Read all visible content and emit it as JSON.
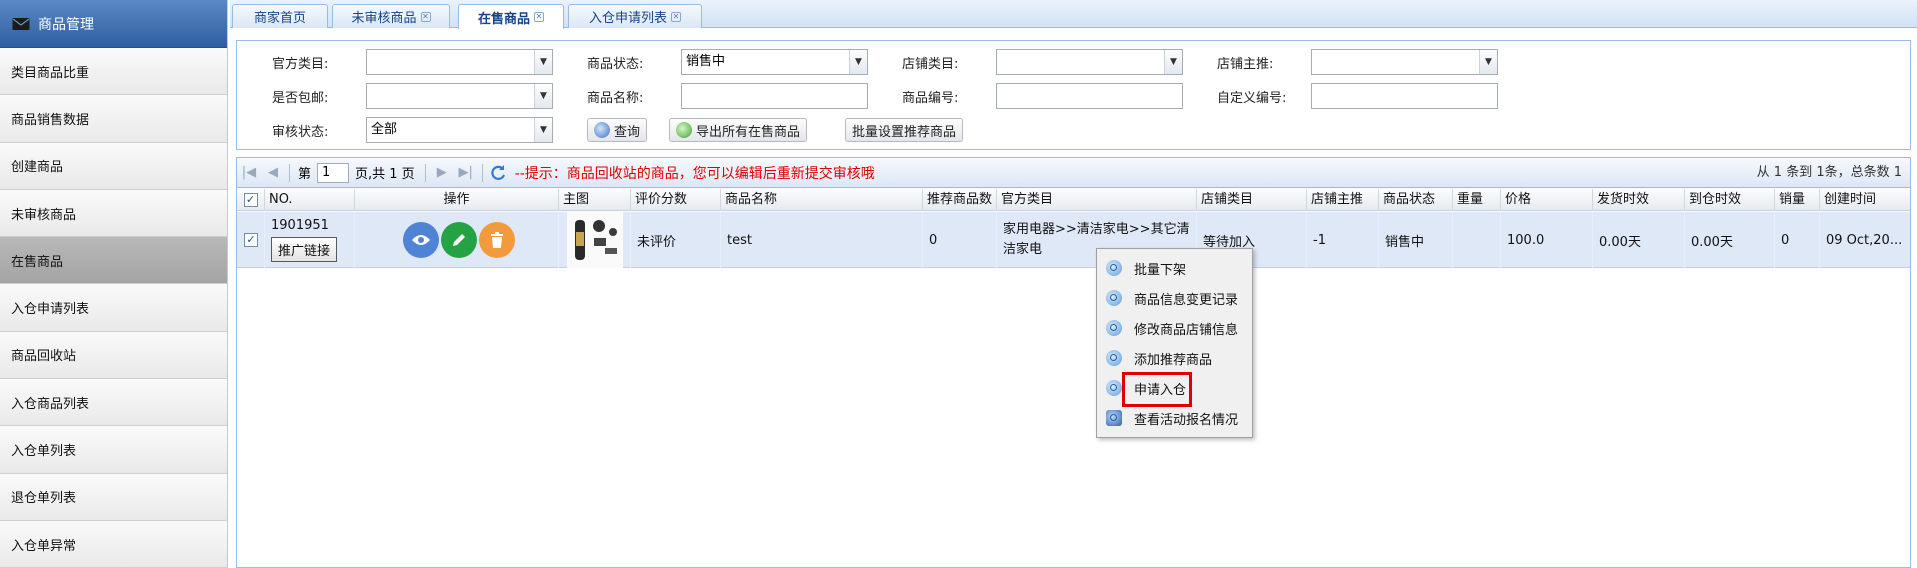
{
  "sidebar": {
    "header": "商品管理",
    "items": [
      {
        "label": "类目商品比重",
        "active": false
      },
      {
        "label": "商品销售数据",
        "active": false
      },
      {
        "label": "创建商品",
        "active": false
      },
      {
        "label": "未审核商品",
        "active": false
      },
      {
        "label": "在售商品",
        "active": true
      },
      {
        "label": "入仓申请列表",
        "active": false
      },
      {
        "label": "商品回收站",
        "active": false
      },
      {
        "label": "入仓商品列表",
        "active": false
      },
      {
        "label": "入仓单列表",
        "active": false
      },
      {
        "label": "退仓单列表",
        "active": false
      },
      {
        "label": "入仓单异常",
        "active": false
      }
    ]
  },
  "tabs": [
    {
      "label": "商家首页",
      "closable": false,
      "active": false
    },
    {
      "label": "未审核商品",
      "closable": true,
      "active": false
    },
    {
      "label": "在售商品",
      "closable": true,
      "active": true
    },
    {
      "label": "入仓申请列表",
      "closable": true,
      "active": false
    }
  ],
  "filters": {
    "official_category_label": "官方类目:",
    "official_category_value": "",
    "product_status_label": "商品状态:",
    "product_status_value": "销售中",
    "store_category_label": "店铺类目:",
    "store_category_value": "",
    "store_featured_label": "店铺主推:",
    "store_featured_value": "",
    "free_shipping_label": "是否包邮:",
    "free_shipping_value": "",
    "product_name_label": "商品名称:",
    "product_name_value": "",
    "product_code_label": "商品编号:",
    "product_code_value": "",
    "custom_code_label": "自定义编号:",
    "custom_code_value": "",
    "review_status_label": "审核状态:",
    "review_status_value": "全部",
    "search_button": "查询",
    "export_button": "导出所有在售商品",
    "batch_recommend_button": "批量设置推荐商品"
  },
  "pager": {
    "page_prefix": "第",
    "page_value": "1",
    "page_suffix": "页,共 1 页",
    "tip": "--提示：商品回收站的商品，您可以编辑后重新提交审核哦",
    "summary": "从 1 条到 1条，总条数 1"
  },
  "columns": [
    "NO.",
    "操作",
    "主图",
    "评价分数",
    "商品名称",
    "推荐商品数",
    "官方类目",
    "店铺类目",
    "店铺主推",
    "商品状态",
    "重量",
    "价格",
    "发货时效",
    "到仓时效",
    "销量",
    "创建时间"
  ],
  "row": {
    "checked": true,
    "no": "1901951",
    "promo_button": "推广链接",
    "rating": "未评价",
    "name": "test",
    "recommend_count": "0",
    "official_category": "家用电器>>清洁家电>>其它清洁家电",
    "store_category": "等待加入",
    "store_featured": "-1",
    "status": "销售中",
    "weight": "",
    "price": "100.0",
    "ship_time": "0.00天",
    "warehouse_time": "0.00天",
    "sales": "0",
    "created": "09 Oct,20..."
  },
  "context_menu": {
    "items": [
      "批量下架",
      "商品信息变更记录",
      "修改商品店铺信息",
      "添加推荐商品",
      "申请入仓",
      "查看活动报名情况"
    ],
    "highlighted": "申请入仓"
  },
  "colors": {
    "header_blue": "#2f5f9f",
    "tab_text": "#15428b",
    "tip_red": "#e00000",
    "row_selected": "#dfe8f6",
    "view_button": "#4f83d6",
    "edit_button": "#25a244",
    "delete_button": "#f39a3a"
  }
}
